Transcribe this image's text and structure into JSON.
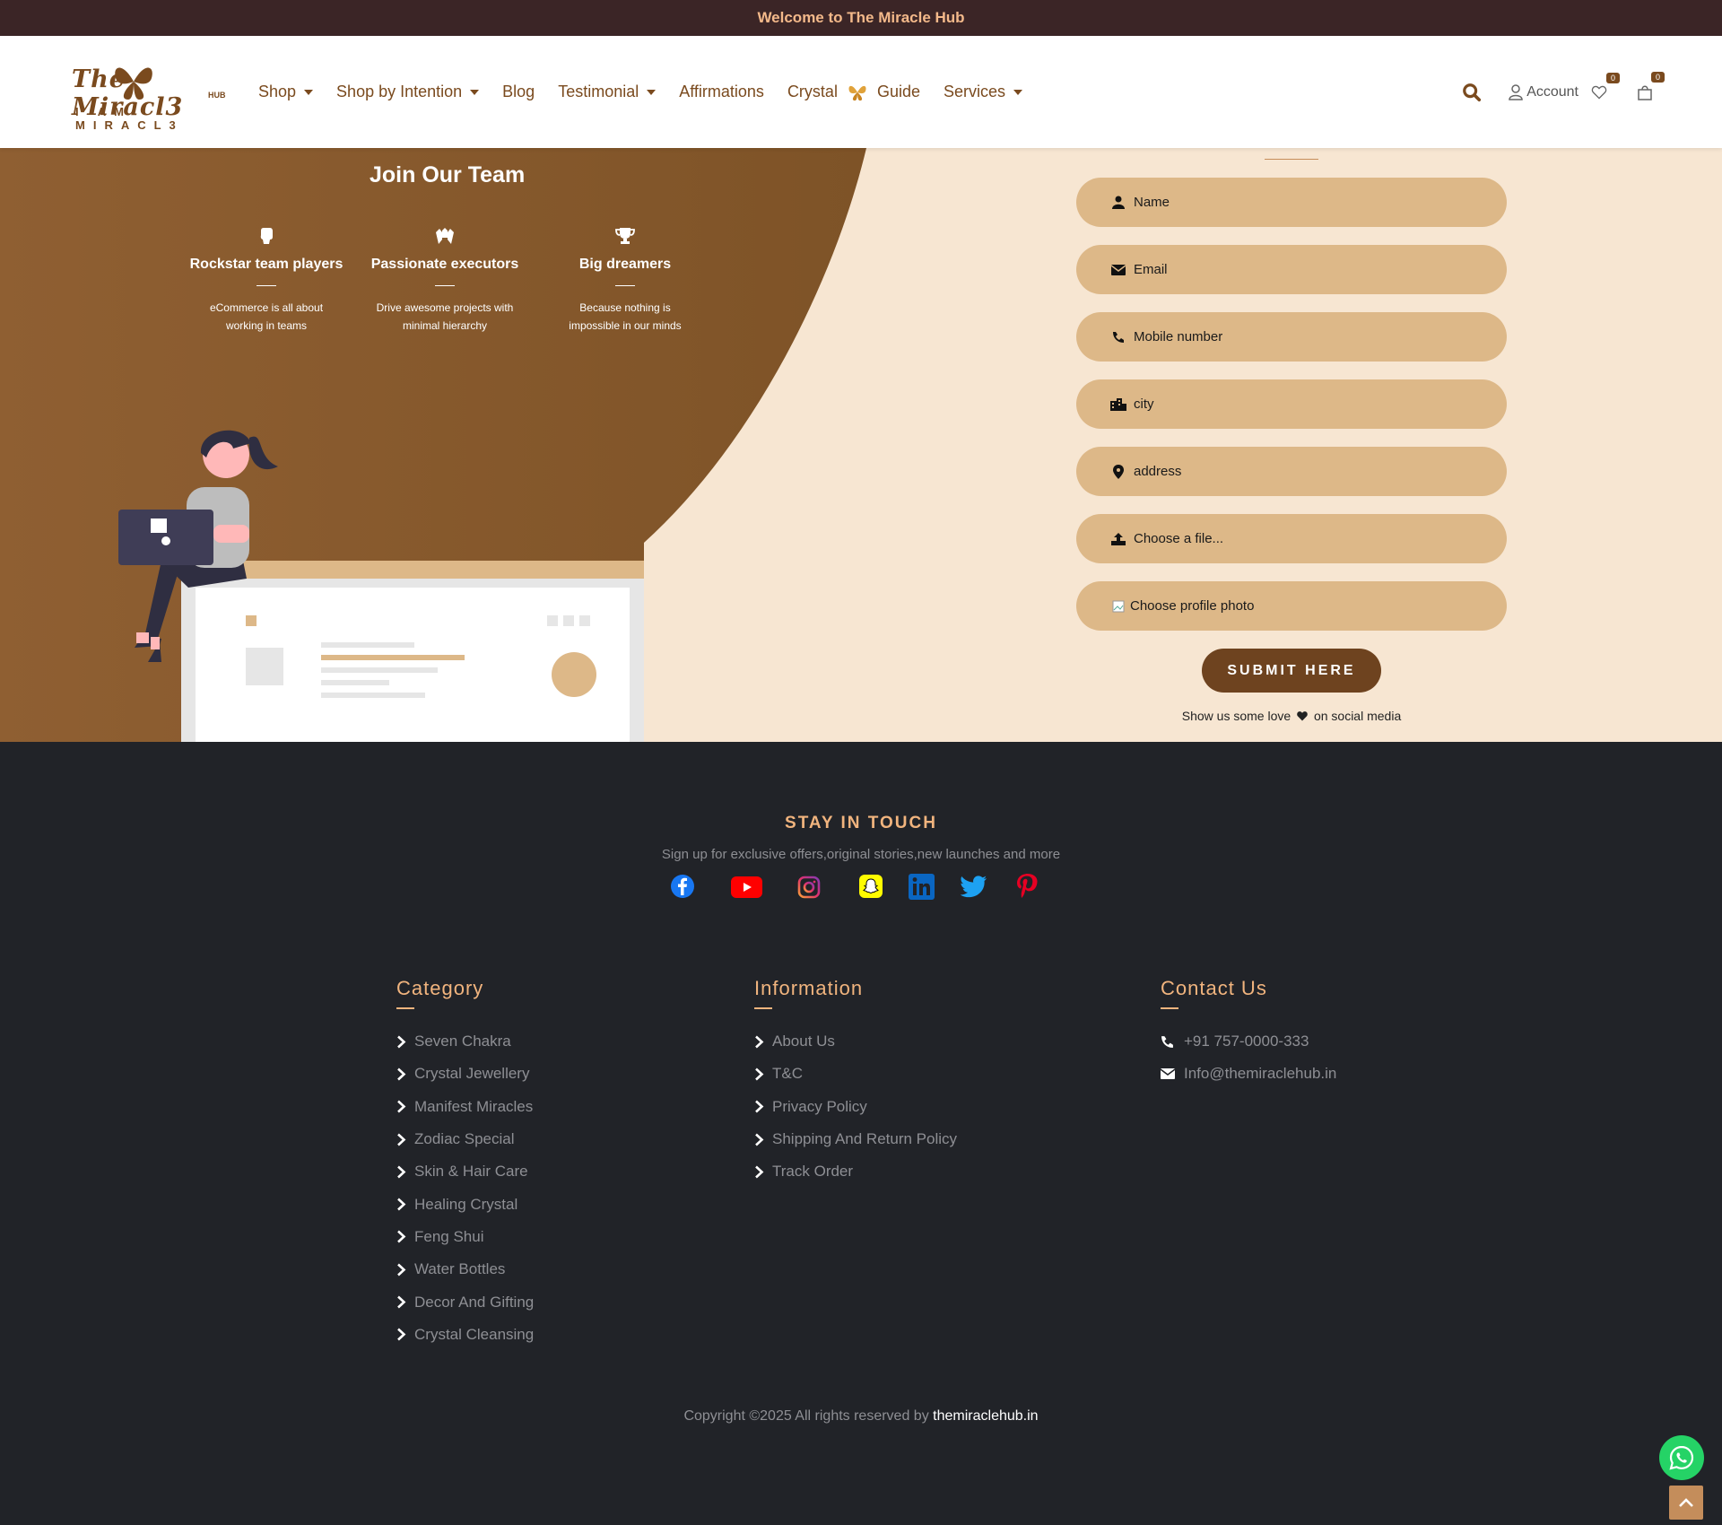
{
  "topbar": {
    "welcome": "Welcome to The Miracle Hub"
  },
  "logo": {
    "line1": "The Miracl3",
    "hub": "HUB",
    "tagline": "I AM MIRACL3"
  },
  "nav": {
    "items": [
      {
        "label": "Shop"
      },
      {
        "label": "Shop by Intention"
      },
      {
        "label": "Blog"
      },
      {
        "label": "Testimonial"
      },
      {
        "label": "Affirmations"
      },
      {
        "label": "Crystal"
      },
      {
        "label": "Guide"
      },
      {
        "label": "Services"
      }
    ]
  },
  "header_actions": {
    "account": "Account",
    "wishlist_count": "0",
    "cart_count": "0"
  },
  "join": {
    "title": "Join Our Team",
    "features": [
      {
        "title": "Rockstar team players",
        "desc1": "eCommerce is all about",
        "desc2": "working in teams"
      },
      {
        "title": "Passionate executors",
        "desc1": "Drive awesome projects with",
        "desc2": "minimal hierarchy"
      },
      {
        "title": "Big dreamers",
        "desc1": "Because nothing is",
        "desc2": "impossible in our minds"
      }
    ]
  },
  "form": {
    "name": "Name",
    "email": "Email",
    "mobile": "Mobile number",
    "city": "city",
    "address": "address",
    "file": "Choose a file...",
    "photo": "Choose profile photo",
    "submit": "SUBMIT HERE",
    "love_pre": "Show us some love",
    "love_post": "on social media"
  },
  "footer": {
    "stay_title": "STAY IN TOUCH",
    "stay_sub": "Sign up for exclusive offers,original stories,new launches and more",
    "category": {
      "title": "Category",
      "items": [
        "Seven Chakra",
        "Crystal Jewellery",
        "Manifest Miracles",
        "Zodiac Special",
        "Skin & Hair Care",
        "Healing Crystal",
        "Feng Shui",
        "Water Bottles",
        "Decor And Gifting",
        "Crystal Cleansing"
      ]
    },
    "information": {
      "title": "Information",
      "items": [
        "About Us",
        "T&C",
        "Privacy Policy",
        "Shipping And Return Policy",
        "Track Order"
      ]
    },
    "contact": {
      "title": "Contact Us",
      "phone": "+91 757-0000-333",
      "email": "Info@themiraclehub.in"
    },
    "copyright_pre": "Copyright ©2025 All rights reserved by",
    "copyright_link": "themiraclehub.in"
  },
  "colors": {
    "brand_brown": "#7a4a1e",
    "accent_tan": "#ddb888",
    "footer_bg": "#212328",
    "topbar_bg": "#3b2526",
    "accent_orange": "#f1b47e"
  },
  "icons": [
    "search-icon",
    "user-icon",
    "heart-icon",
    "bag-icon",
    "butterfly-icon",
    "facebook-icon",
    "youtube-icon",
    "instagram-icon",
    "snapchat-icon",
    "linkedin-icon",
    "twitter-icon",
    "pinterest-icon",
    "whatsapp-icon",
    "arrow-up-icon"
  ]
}
